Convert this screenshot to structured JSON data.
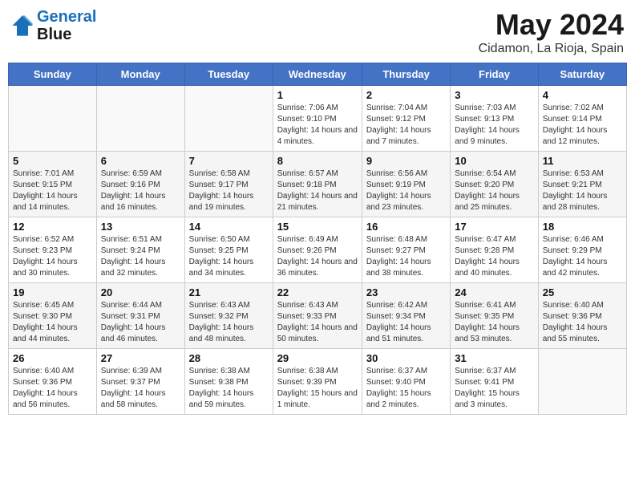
{
  "header": {
    "logo_line1": "General",
    "logo_line2": "Blue",
    "month": "May 2024",
    "location": "Cidamon, La Rioja, Spain"
  },
  "weekdays": [
    "Sunday",
    "Monday",
    "Tuesday",
    "Wednesday",
    "Thursday",
    "Friday",
    "Saturday"
  ],
  "weeks": [
    [
      {
        "day": "",
        "info": ""
      },
      {
        "day": "",
        "info": ""
      },
      {
        "day": "",
        "info": ""
      },
      {
        "day": "1",
        "info": "Sunrise: 7:06 AM\nSunset: 9:10 PM\nDaylight: 14 hours and 4 minutes."
      },
      {
        "day": "2",
        "info": "Sunrise: 7:04 AM\nSunset: 9:12 PM\nDaylight: 14 hours and 7 minutes."
      },
      {
        "day": "3",
        "info": "Sunrise: 7:03 AM\nSunset: 9:13 PM\nDaylight: 14 hours and 9 minutes."
      },
      {
        "day": "4",
        "info": "Sunrise: 7:02 AM\nSunset: 9:14 PM\nDaylight: 14 hours and 12 minutes."
      }
    ],
    [
      {
        "day": "5",
        "info": "Sunrise: 7:01 AM\nSunset: 9:15 PM\nDaylight: 14 hours and 14 minutes."
      },
      {
        "day": "6",
        "info": "Sunrise: 6:59 AM\nSunset: 9:16 PM\nDaylight: 14 hours and 16 minutes."
      },
      {
        "day": "7",
        "info": "Sunrise: 6:58 AM\nSunset: 9:17 PM\nDaylight: 14 hours and 19 minutes."
      },
      {
        "day": "8",
        "info": "Sunrise: 6:57 AM\nSunset: 9:18 PM\nDaylight: 14 hours and 21 minutes."
      },
      {
        "day": "9",
        "info": "Sunrise: 6:56 AM\nSunset: 9:19 PM\nDaylight: 14 hours and 23 minutes."
      },
      {
        "day": "10",
        "info": "Sunrise: 6:54 AM\nSunset: 9:20 PM\nDaylight: 14 hours and 25 minutes."
      },
      {
        "day": "11",
        "info": "Sunrise: 6:53 AM\nSunset: 9:21 PM\nDaylight: 14 hours and 28 minutes."
      }
    ],
    [
      {
        "day": "12",
        "info": "Sunrise: 6:52 AM\nSunset: 9:23 PM\nDaylight: 14 hours and 30 minutes."
      },
      {
        "day": "13",
        "info": "Sunrise: 6:51 AM\nSunset: 9:24 PM\nDaylight: 14 hours and 32 minutes."
      },
      {
        "day": "14",
        "info": "Sunrise: 6:50 AM\nSunset: 9:25 PM\nDaylight: 14 hours and 34 minutes."
      },
      {
        "day": "15",
        "info": "Sunrise: 6:49 AM\nSunset: 9:26 PM\nDaylight: 14 hours and 36 minutes."
      },
      {
        "day": "16",
        "info": "Sunrise: 6:48 AM\nSunset: 9:27 PM\nDaylight: 14 hours and 38 minutes."
      },
      {
        "day": "17",
        "info": "Sunrise: 6:47 AM\nSunset: 9:28 PM\nDaylight: 14 hours and 40 minutes."
      },
      {
        "day": "18",
        "info": "Sunrise: 6:46 AM\nSunset: 9:29 PM\nDaylight: 14 hours and 42 minutes."
      }
    ],
    [
      {
        "day": "19",
        "info": "Sunrise: 6:45 AM\nSunset: 9:30 PM\nDaylight: 14 hours and 44 minutes."
      },
      {
        "day": "20",
        "info": "Sunrise: 6:44 AM\nSunset: 9:31 PM\nDaylight: 14 hours and 46 minutes."
      },
      {
        "day": "21",
        "info": "Sunrise: 6:43 AM\nSunset: 9:32 PM\nDaylight: 14 hours and 48 minutes."
      },
      {
        "day": "22",
        "info": "Sunrise: 6:43 AM\nSunset: 9:33 PM\nDaylight: 14 hours and 50 minutes."
      },
      {
        "day": "23",
        "info": "Sunrise: 6:42 AM\nSunset: 9:34 PM\nDaylight: 14 hours and 51 minutes."
      },
      {
        "day": "24",
        "info": "Sunrise: 6:41 AM\nSunset: 9:35 PM\nDaylight: 14 hours and 53 minutes."
      },
      {
        "day": "25",
        "info": "Sunrise: 6:40 AM\nSunset: 9:36 PM\nDaylight: 14 hours and 55 minutes."
      }
    ],
    [
      {
        "day": "26",
        "info": "Sunrise: 6:40 AM\nSunset: 9:36 PM\nDaylight: 14 hours and 56 minutes."
      },
      {
        "day": "27",
        "info": "Sunrise: 6:39 AM\nSunset: 9:37 PM\nDaylight: 14 hours and 58 minutes."
      },
      {
        "day": "28",
        "info": "Sunrise: 6:38 AM\nSunset: 9:38 PM\nDaylight: 14 hours and 59 minutes."
      },
      {
        "day": "29",
        "info": "Sunrise: 6:38 AM\nSunset: 9:39 PM\nDaylight: 15 hours and 1 minute."
      },
      {
        "day": "30",
        "info": "Sunrise: 6:37 AM\nSunset: 9:40 PM\nDaylight: 15 hours and 2 minutes."
      },
      {
        "day": "31",
        "info": "Sunrise: 6:37 AM\nSunset: 9:41 PM\nDaylight: 15 hours and 3 minutes."
      },
      {
        "day": "",
        "info": ""
      }
    ]
  ]
}
